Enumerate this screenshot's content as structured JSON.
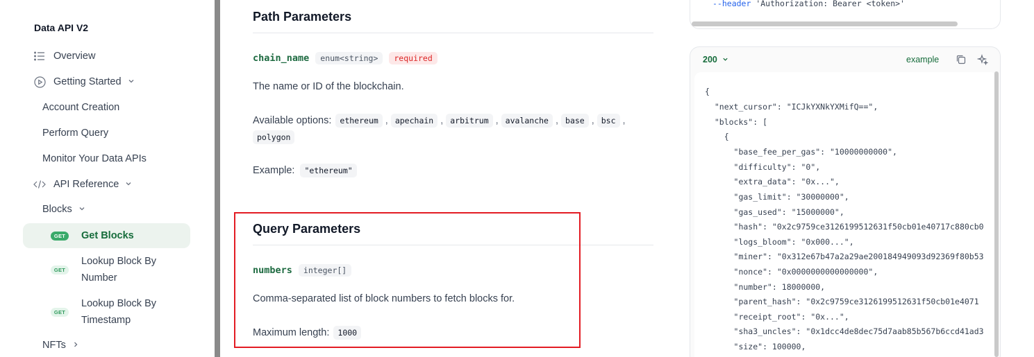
{
  "sidebar": {
    "title": "Data API V2",
    "overview": "Overview",
    "getting_started": "Getting Started",
    "account_creation": "Account Creation",
    "perform_query": "Perform Query",
    "monitor": "Monitor Your Data APIs",
    "api_reference": "API Reference",
    "blocks": "Blocks",
    "get_badge": "GET",
    "get_blocks": "Get Blocks",
    "lookup_by_number": "Lookup Block By Number",
    "lookup_by_timestamp": "Lookup Block By Timestamp",
    "nfts": "NFTs"
  },
  "path_params": {
    "title": "Path Parameters",
    "name": "chain_name",
    "type": "enum<string>",
    "required": "required",
    "description": "The name or ID of the blockchain.",
    "options_label": "Available options:",
    "options": [
      "ethereum",
      "apechain",
      "arbitrum",
      "avalanche",
      "base",
      "bsc",
      "polygon"
    ],
    "example_label": "Example:",
    "example_value": "\"ethereum\""
  },
  "query_params": {
    "title": "Query Parameters",
    "name": "numbers",
    "type": "integer[]",
    "description": "Comma-separated list of block numbers to fetch blocks for.",
    "max_label": "Maximum length:",
    "max_value": "1000"
  },
  "request": {
    "header_flag": "--header",
    "header_value": "'Authorization: Bearer <token>'"
  },
  "response": {
    "status": "200",
    "example_label": "example",
    "lines": [
      "{",
      "  \"next_cursor\": \"ICJkYXNkYXMifQ==\",",
      "  \"blocks\": [",
      "    {",
      "      \"base_fee_per_gas\": \"10000000000\",",
      "      \"difficulty\": \"0\",",
      "      \"extra_data\": \"0x...\",",
      "      \"gas_limit\": \"30000000\",",
      "      \"gas_used\": \"15000000\",",
      "      \"hash\": \"0x2c9759ce3126199512631f50cb01e40717c880cb0",
      "      \"logs_bloom\": \"0x000...\",",
      "      \"miner\": \"0x312e67b47a2a29ae200184949093d92369f80b53",
      "      \"nonce\": \"0x0000000000000000\",",
      "      \"number\": 18000000,",
      "      \"parent_hash\": \"0x2c9759ce3126199512631f50cb01e4071",
      "      \"receipt_root\": \"0x...\",",
      "      \"sha3_uncles\": \"0x1dcc4de8dec75d7aab85b567b6ccd41ad3",
      "      \"size\": 100000,"
    ]
  },
  "colors": {
    "accent_green": "#166c3b",
    "highlight_red": "#e31b23",
    "required_red": "#dc2626"
  }
}
